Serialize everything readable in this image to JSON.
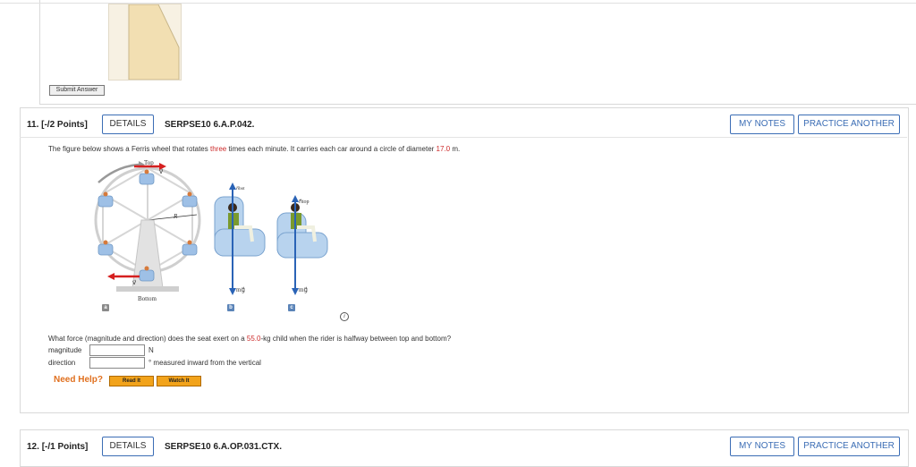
{
  "prev_question": {
    "submit_label": "Submit Answer"
  },
  "q11": {
    "number": "11.",
    "points": "[-/2 Points]",
    "details": "DETAILS",
    "code": "SERPSE10 6.A.P.042.",
    "my_notes": "MY NOTES",
    "practice": "PRACTICE ANOTHER",
    "text_a": "The figure below shows a Ferris wheel that rotates ",
    "text_red1": "three",
    "text_b": " times each minute. It carries each car around a circle of diameter ",
    "text_red2": "17.0",
    "text_c": " m.",
    "figure": {
      "top": "Top",
      "bottom": "Bottom",
      "R": "R",
      "v_top": "v⃗",
      "v_bottom": "v⃗",
      "n_bot": "n⃗bot",
      "n_top": "n⃗top",
      "mg_b": "mg⃗",
      "mg_c": "mg⃗",
      "tag_a": "a",
      "tag_b": "b",
      "tag_c": "c",
      "info": "i"
    },
    "question_a": "What force (magnitude and direction) does the seat exert on a ",
    "question_red": "55.0",
    "question_b": "-kg child when the rider is halfway between top and bottom?",
    "magnitude_label": "magnitude",
    "magnitude_value": "",
    "magnitude_unit": "N",
    "direction_label": "direction",
    "direction_value": "",
    "direction_unit": "° measured inward from the vertical",
    "need_help": "Need Help?",
    "read_it": "Read It",
    "watch_it": "Watch It"
  },
  "q12": {
    "number": "12.",
    "points": "[-/1 Points]",
    "details": "DETAILS",
    "code": "SERPSE10 6.A.OP.031.CTX.",
    "my_notes": "MY NOTES",
    "practice": "PRACTICE ANOTHER"
  },
  "colors": {
    "accent_blue": "#3b6db5",
    "red": "#cc2a2a",
    "help_orange": "#f2a31b",
    "help_text": "#e0701f"
  }
}
